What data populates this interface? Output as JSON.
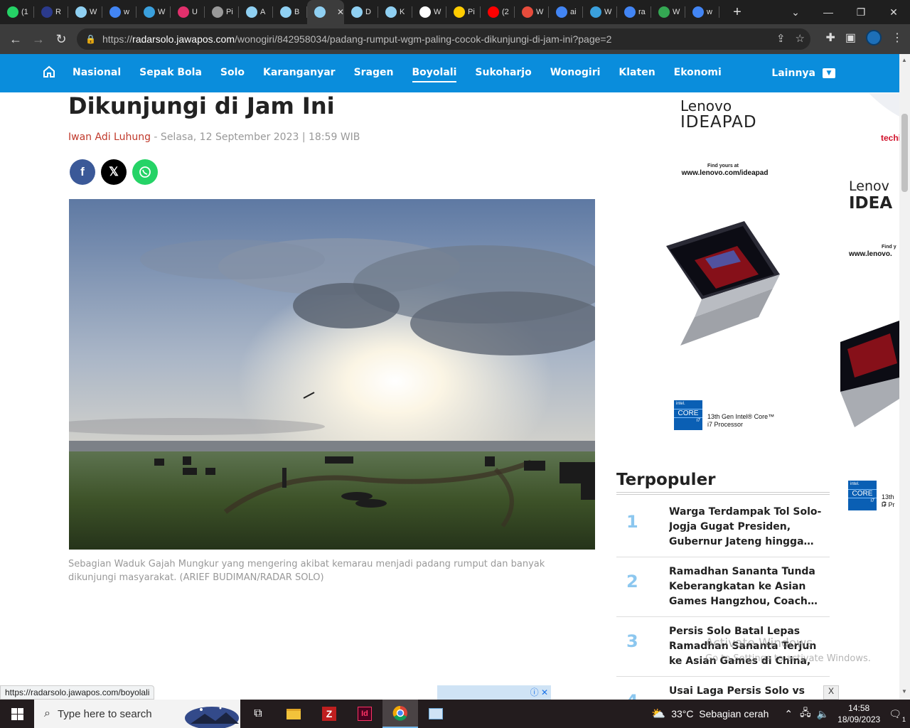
{
  "tabs": [
    {
      "label": "(1",
      "icon": "whatsapp-icon",
      "color": "#25d366"
    },
    {
      "label": "R",
      "icon": "person-icon",
      "color": "#2b3a8c"
    },
    {
      "label": "W",
      "icon": "globe-icon",
      "color": "#8fd0f2"
    },
    {
      "label": "w",
      "icon": "google-icon",
      "color": "#4285f4"
    },
    {
      "label": "W",
      "icon": "book-icon",
      "color": "#3aa0dd"
    },
    {
      "label": "U",
      "icon": "instagram-icon",
      "color": "#e1306c"
    },
    {
      "label": "Pi",
      "icon": "loading-icon",
      "color": "#999999"
    },
    {
      "label": "A",
      "icon": "globe-icon",
      "color": "#8fd0f2"
    },
    {
      "label": "B",
      "icon": "globe-icon",
      "color": "#8fd0f2"
    },
    {
      "label": "",
      "icon": "globe-icon",
      "color": "#8fd0f2",
      "active": true
    },
    {
      "label": "D",
      "icon": "globe-icon",
      "color": "#8fd0f2"
    },
    {
      "label": "K",
      "icon": "globe-icon",
      "color": "#8fd0f2"
    },
    {
      "label": "W",
      "icon": "wikipedia-icon",
      "color": "#ffffff"
    },
    {
      "label": "Pi",
      "icon": "flag-icon",
      "color": "#ffcc00"
    },
    {
      "label": "(2",
      "icon": "youtube-icon",
      "color": "#ff0000"
    },
    {
      "label": "W",
      "icon": "grid-icon",
      "color": "#e74c3c"
    },
    {
      "label": "ai",
      "icon": "google-icon",
      "color": "#4285f4"
    },
    {
      "label": "W",
      "icon": "book-icon",
      "color": "#3aa0dd"
    },
    {
      "label": "ra",
      "icon": "google-icon",
      "color": "#4285f4"
    },
    {
      "label": "W",
      "icon": "maps-icon",
      "color": "#34a853"
    },
    {
      "label": "w",
      "icon": "google-icon",
      "color": "#4285f4"
    }
  ],
  "browser": {
    "url_host": "radarsolo.jawapos.com",
    "url_path": "/wonogiri/842958034/padang-rumput-wgm-paling-cocok-dikunjungi-di-jam-ini?page=2",
    "url_prefix": "https://"
  },
  "nav": {
    "items": [
      "Nasional",
      "Sepak Bola",
      "Solo",
      "Karanganyar",
      "Sragen",
      "Boyolali",
      "Sukoharjo",
      "Wonogiri",
      "Klaten",
      "Ekonomi"
    ],
    "active": "Boyolali",
    "more": "Lainnya"
  },
  "article": {
    "title": "Dikunjungi di Jam Ini",
    "author": "Iwan Adi Luhung",
    "date": " - Selasa, 12 September 2023 | 18:59 WIB",
    "caption": "Sebagian Waduk Gajah Mungkur yang mengering akibat kemarau menjadi padang rumput dan banyak dikunjungi masyarakat. (ARIEF BUDIMAN/RADAR SOLO)"
  },
  "ad": {
    "brand1": "Lenovo",
    "brand2": "IDEAPAD",
    "find": "Find yours at",
    "site": "www.lenovo.com/ideapad",
    "chip_top": "intel.",
    "chip": "CORE",
    "chip_sub": "i7",
    "proc1": "13th Gen Intel® Core™",
    "proc2": "i7 Processor",
    "brand1_cut": "Lenov",
    "brand2_cut": "IDEA",
    "find_cut": "Find y",
    "site_cut": "www.lenovo.",
    "proc1_cut": "13th G",
    "proc2_cut": "i7 Pr",
    "tech_cut": "techi"
  },
  "popular": {
    "heading": "Terpopuler",
    "items": [
      {
        "num": "1",
        "text": "Warga Terdampak Tol Solo-Jogja Gugat Presiden, Gubernur Jateng hingga…"
      },
      {
        "num": "2",
        "text": "Ramadhan Sananta Tunda Keberangkatan ke Asian Games Hangzhou, Coach…"
      },
      {
        "num": "3",
        "text": "Persis Solo Batal Lepas Ramadhan Sananta Terjun ke Asian Games di China, In…"
      },
      {
        "num": "4",
        "text": "Usai Laga Persis Solo vs PSIS"
      }
    ]
  },
  "status_url": "https://radarsolo.jawapos.com/boyolali",
  "close_label": "X",
  "activate": {
    "line1": "Activate Windows",
    "line2": "Go to Settings to activate Windows."
  },
  "taskbar": {
    "search_placeholder": "Type here to search",
    "weather": "33°C  Sebagian cerah",
    "time": "14:58",
    "date": "18/09/2023",
    "notif_count": "1"
  }
}
